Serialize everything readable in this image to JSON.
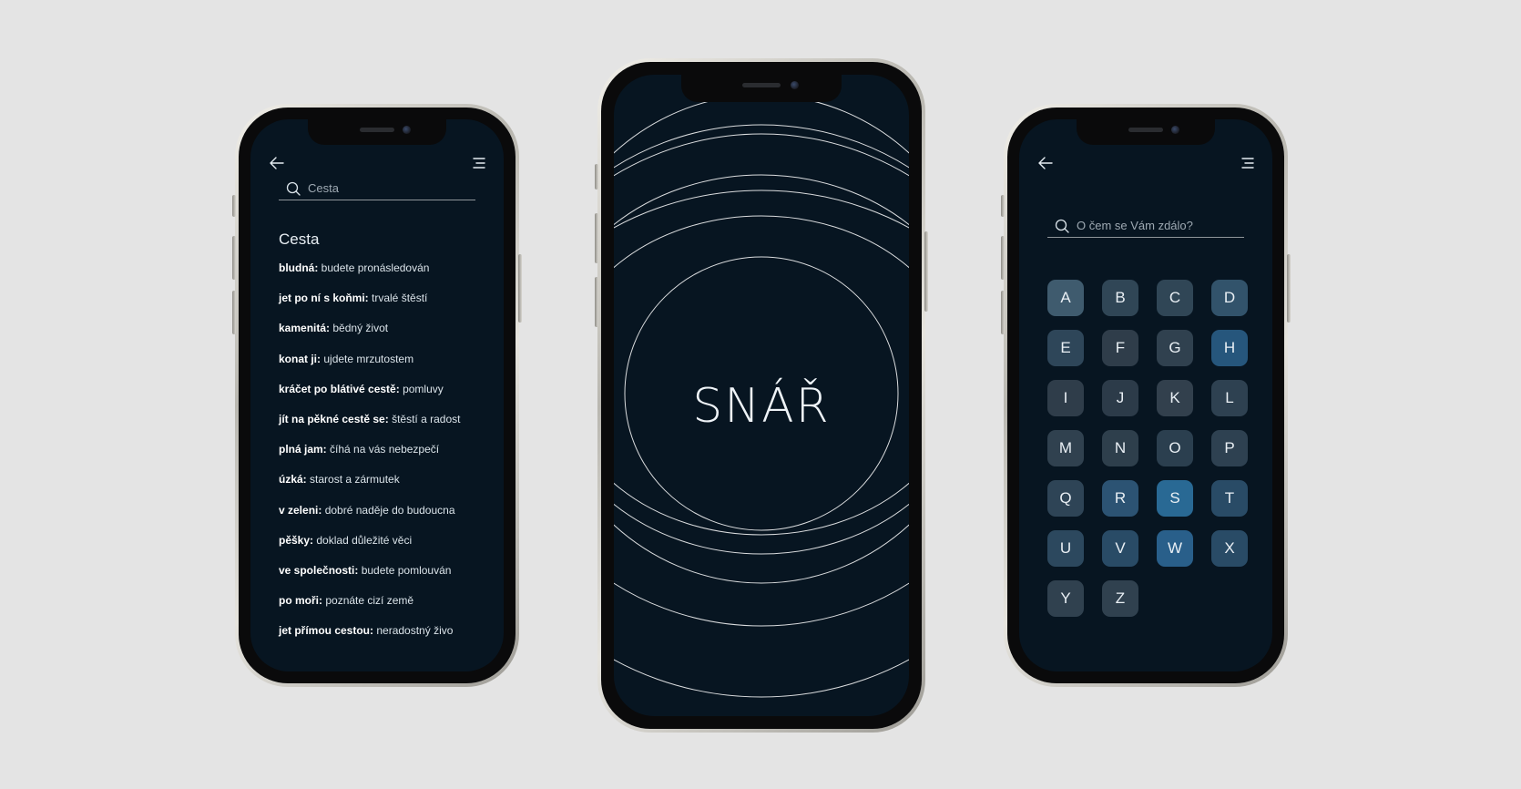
{
  "left_screen": {
    "search": {
      "value": "Cesta",
      "placeholder": "Cesta"
    },
    "heading": "Cesta",
    "entries": [
      {
        "term": "bludná:",
        "meaning": "budete pronásledován"
      },
      {
        "term": "jet po ní s koňmi:",
        "meaning": "trvalé štěstí"
      },
      {
        "term": "kamenitá:",
        "meaning": "bědný život"
      },
      {
        "term": "konat ji:",
        "meaning": "ujdete mrzutostem"
      },
      {
        "term": "kráčet po blátivé cestě:",
        "meaning": "pomluvy"
      },
      {
        "term": "jít na pěkné cestě se:",
        "meaning": "štěstí a radost"
      },
      {
        "term": "plná jam:",
        "meaning": "číhá na vás nebezpečí"
      },
      {
        "term": "úzká:",
        "meaning": "starost a zármutek"
      },
      {
        "term": "v zeleni:",
        "meaning": "dobré naděje do budoucna"
      },
      {
        "term": "pěšky:",
        "meaning": "doklad důležité věci"
      },
      {
        "term": "ve společnosti:",
        "meaning": "budete pomlouván"
      },
      {
        "term": "po moři:",
        "meaning": "poznáte cizí země"
      },
      {
        "term": "jet přímou cestou:",
        "meaning": "neradostný živo"
      }
    ],
    "icons": {
      "back": "arrow-left-icon",
      "menu": "menu-icon",
      "search": "search-icon"
    }
  },
  "center_screen": {
    "title": "SNÁŘ"
  },
  "right_screen": {
    "search": {
      "placeholder": "O čem se Vám zdálo?"
    },
    "letters": [
      "A",
      "B",
      "C",
      "D",
      "E",
      "F",
      "G",
      "H",
      "I",
      "J",
      "K",
      "L",
      "M",
      "N",
      "O",
      "P",
      "Q",
      "R",
      "S",
      "T",
      "U",
      "V",
      "W",
      "X",
      "Y",
      "Z"
    ],
    "icons": {
      "back": "arrow-left-icon",
      "menu": "menu-icon",
      "search": "search-icon"
    }
  },
  "colors": {
    "page_background": "#e4e4e4",
    "screen_dark": "#071521",
    "accent_blue": "#1d74b0",
    "text_light": "#e8eef3"
  }
}
